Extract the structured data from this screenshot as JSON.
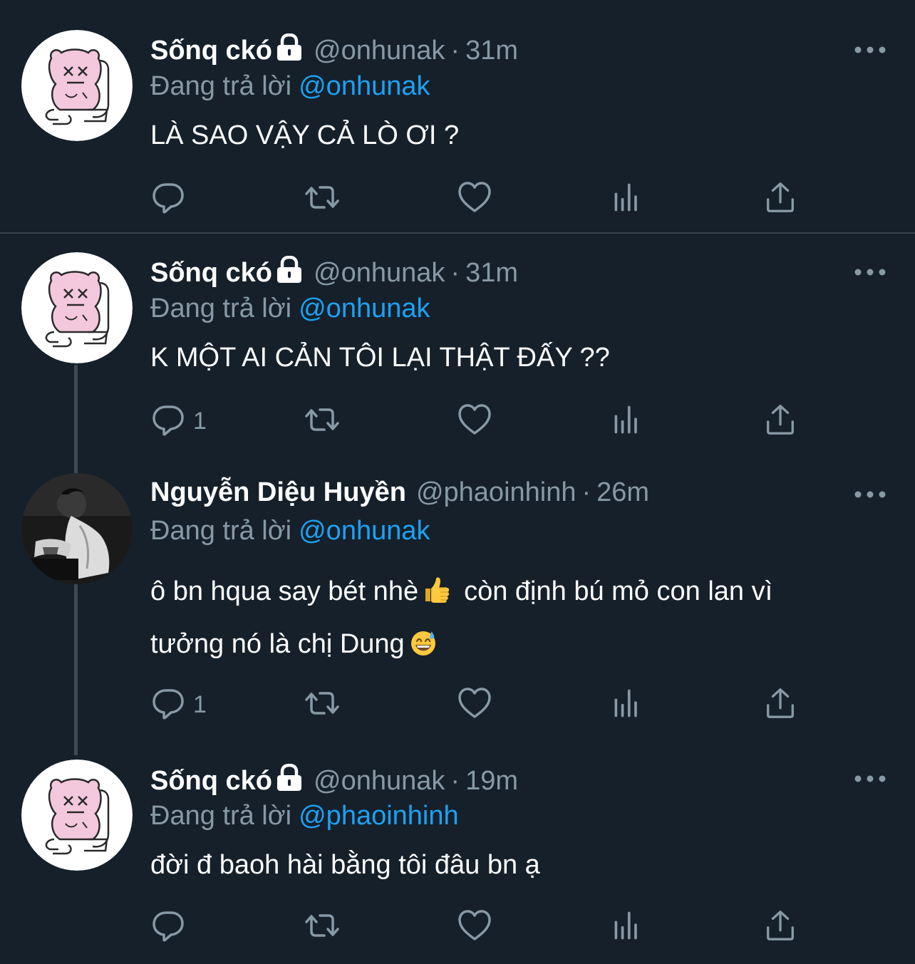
{
  "tweets": [
    {
      "display_name": "Sốnq ckó",
      "handle": "@onhunak",
      "separator": "·",
      "time": "31m",
      "replying_prefix": "Đang trả lời",
      "replying_to": "@onhunak",
      "text": "LÀ SAO VẬY CẢ LÒ ƠI ?",
      "reply_count": "",
      "locked": true,
      "avatar_icon": "pink-cartoon-avatar-icon"
    },
    {
      "display_name": "Sốnq ckó",
      "handle": "@onhunak",
      "separator": "·",
      "time": "31m",
      "replying_prefix": "Đang trả lời",
      "replying_to": "@onhunak",
      "text": "K MỘT AI CẢN TÔI LẠI THẬT ĐẤY ??",
      "reply_count": "1",
      "locked": true,
      "avatar_icon": "pink-cartoon-avatar-icon"
    },
    {
      "display_name": "Nguyễn Diệu Huyền",
      "handle": "@phaoinhinh",
      "separator": "·",
      "time": "26m",
      "replying_prefix": "Đang trả lời",
      "replying_to": "@onhunak",
      "text_line1_a": "ô bn hqua say bét nhè",
      "text_line1_b": "còn định bú mỏ con lan vì",
      "text_line2": "tưởng nó là chị Dung",
      "reply_count": "1",
      "locked": false,
      "avatar_icon": "monochrome-photo-avatar-icon"
    },
    {
      "display_name": "Sốnq ckó",
      "handle": "@onhunak",
      "separator": "·",
      "time": "19m",
      "replying_prefix": "Đang trả lời",
      "replying_to": "@phaoinhinh",
      "text": "đời đ baoh hài bằng tôi đâu bn ạ",
      "reply_count": "",
      "locked": true,
      "avatar_icon": "pink-cartoon-avatar-icon"
    }
  ],
  "icons": {
    "reply": "reply-icon",
    "retweet": "retweet-icon",
    "like": "heart-icon",
    "analytics": "analytics-icon",
    "share": "share-icon",
    "more": "more-options-icon",
    "lock": "lock-icon",
    "thumbs_up": "thumbs-up-emoji",
    "sweat_smile": "grinning-sweat-emoji"
  },
  "colors": {
    "background": "#15202b",
    "primary_text": "#ffffff",
    "secondary_text": "#8899a6",
    "link": "#1da1f2",
    "divider": "#38444d"
  }
}
